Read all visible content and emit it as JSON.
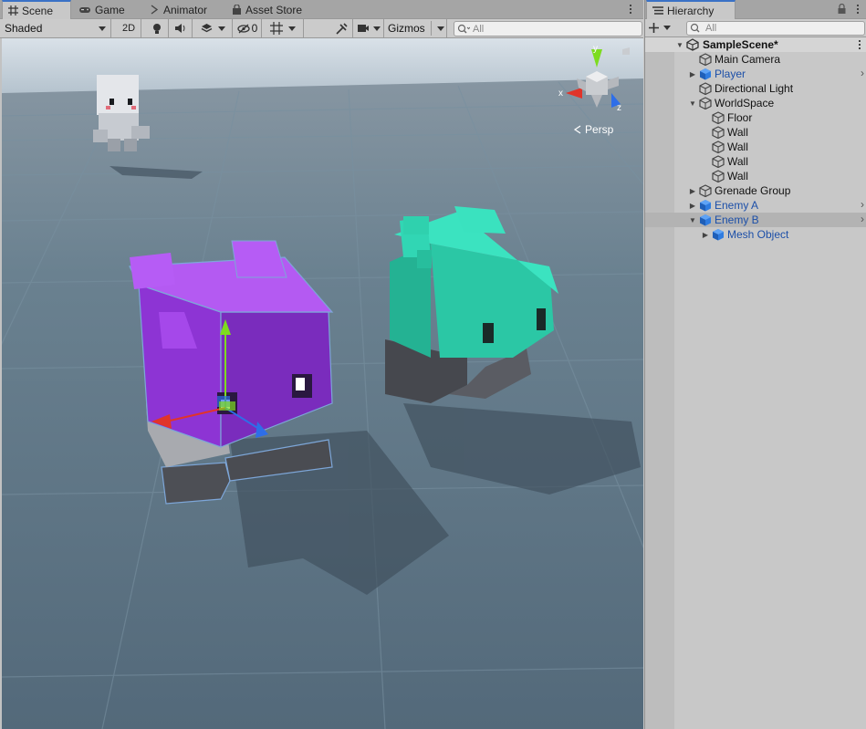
{
  "scene_tabs": [
    {
      "label": "Scene",
      "icon": "grid-icon"
    },
    {
      "label": "Game",
      "icon": "gamepad-icon"
    },
    {
      "label": "Animator",
      "icon": "animator-icon"
    },
    {
      "label": "Asset Store",
      "icon": "shopping-bag-icon"
    }
  ],
  "scene_toolbar": {
    "shading_mode": "Shaded",
    "two_d_label": "2D",
    "hidden_count": "0",
    "gizmos_label": "Gizmos",
    "search_placeholder": "All"
  },
  "viewport": {
    "projection_label": "Persp",
    "axis_labels": {
      "x": "x",
      "y": "y",
      "z": "z"
    },
    "ground_color": "#5f7685",
    "sky_color": "#c8d3de"
  },
  "hierarchy": {
    "title": "Hierarchy",
    "search_placeholder": "All",
    "scene_name": "SampleScene*",
    "items": [
      {
        "label": "Main Camera",
        "depth": 1,
        "expander": "",
        "prefab": false,
        "selected": false,
        "has_chevron": false
      },
      {
        "label": "Player",
        "depth": 1,
        "expander": "collapsed",
        "prefab": true,
        "selected": false,
        "has_chevron": true
      },
      {
        "label": "Directional Light",
        "depth": 1,
        "expander": "",
        "prefab": false,
        "selected": false,
        "has_chevron": false
      },
      {
        "label": "WorldSpace",
        "depth": 1,
        "expander": "expanded",
        "prefab": false,
        "selected": false,
        "has_chevron": false
      },
      {
        "label": "Floor",
        "depth": 2,
        "expander": "",
        "prefab": false,
        "selected": false,
        "has_chevron": false
      },
      {
        "label": "Wall",
        "depth": 2,
        "expander": "",
        "prefab": false,
        "selected": false,
        "has_chevron": false
      },
      {
        "label": "Wall",
        "depth": 2,
        "expander": "",
        "prefab": false,
        "selected": false,
        "has_chevron": false
      },
      {
        "label": "Wall",
        "depth": 2,
        "expander": "",
        "prefab": false,
        "selected": false,
        "has_chevron": false
      },
      {
        "label": "Wall",
        "depth": 2,
        "expander": "",
        "prefab": false,
        "selected": false,
        "has_chevron": false
      },
      {
        "label": "Grenade Group",
        "depth": 1,
        "expander": "collapsed",
        "prefab": false,
        "selected": false,
        "has_chevron": false
      },
      {
        "label": "Enemy A",
        "depth": 1,
        "expander": "collapsed",
        "prefab": true,
        "selected": false,
        "has_chevron": true
      },
      {
        "label": "Enemy B",
        "depth": 1,
        "expander": "expanded",
        "prefab": true,
        "selected": true,
        "has_chevron": true
      },
      {
        "label": "Mesh Object",
        "depth": 2,
        "expander": "collapsed",
        "prefab": true,
        "selected": false,
        "has_chevron": false
      }
    ]
  },
  "colors": {
    "accent": "#3a72c6",
    "prefab_text": "#1c4fa8",
    "enemy_purple": "#9b3fe0",
    "enemy_teal": "#2fd9b6",
    "gizmo_x": "#e0342a",
    "gizmo_y": "#7ddc1f",
    "gizmo_z": "#2e6ee8"
  }
}
